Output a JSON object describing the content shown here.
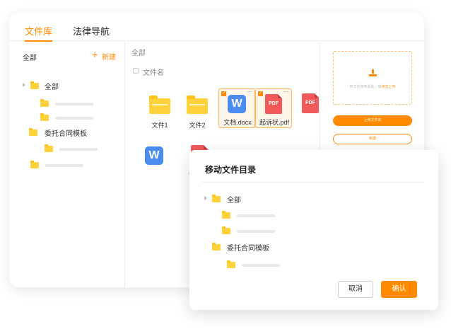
{
  "tabs": [
    {
      "label": "文件库",
      "active": true
    },
    {
      "label": "法律导航",
      "active": false
    }
  ],
  "sidebar": {
    "header_label": "全部",
    "new_label": "新建",
    "tree": [
      {
        "label": "全部"
      },
      {
        "label": "委托合同模板"
      }
    ]
  },
  "main": {
    "breadcrumb": "全部",
    "column_header": "文件名",
    "files": [
      {
        "name": "文件1",
        "type": "folder"
      },
      {
        "name": "文件2",
        "type": "folder"
      },
      {
        "name": "文档.docx",
        "type": "word",
        "selected": true,
        "icon_text": "W"
      },
      {
        "name": "起诉状.pdf",
        "type": "pdf",
        "selected": true,
        "icon_text": "PDF"
      },
      {
        "name": "",
        "type": "pdf",
        "icon_text": "PDF"
      },
      {
        "name": "",
        "type": "word",
        "icon_text": "W"
      },
      {
        "name": "",
        "type": "pdf",
        "icon_text": "PDF"
      }
    ]
  },
  "upload": {
    "drop_text": "将文件拖到此处，或",
    "drop_link": "点击上传",
    "upload_button": "上传文件夹",
    "new_button": "新建"
  },
  "dialog": {
    "title": "移动文件目录",
    "tree": [
      {
        "label": "全部"
      },
      {
        "label": "委托合同模板"
      }
    ],
    "cancel_label": "取消",
    "confirm_label": "确认"
  },
  "colors": {
    "accent": "#ff8a00",
    "folder": "#ffd23c",
    "word": "#4a8cf0",
    "pdf": "#f25a5a"
  }
}
